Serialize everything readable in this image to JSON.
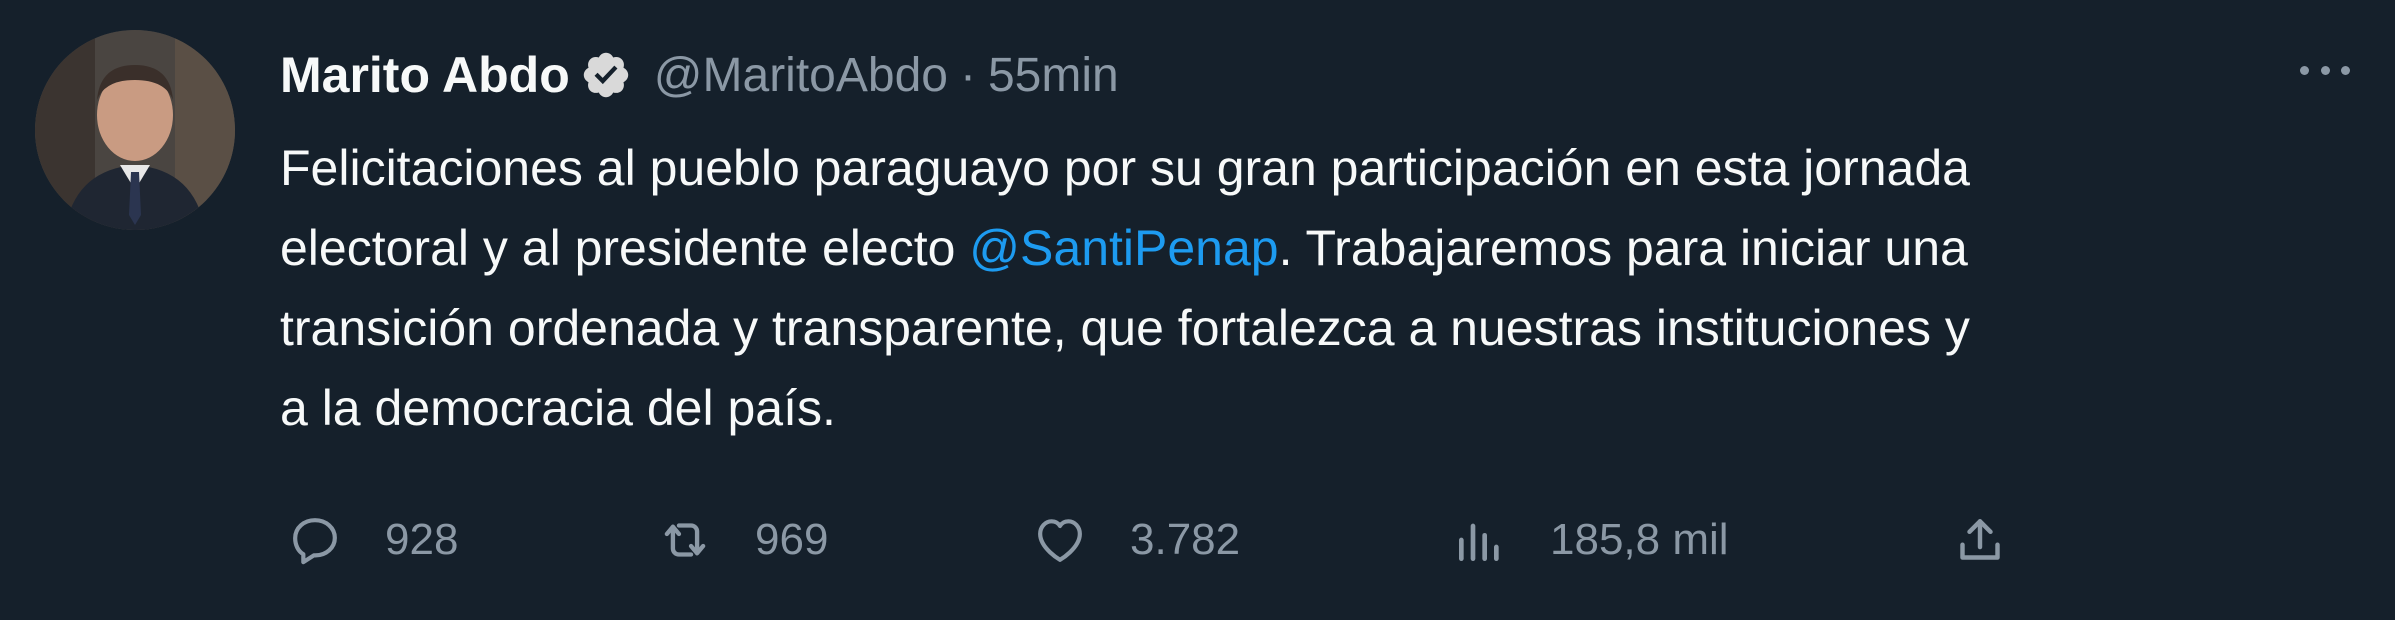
{
  "author": {
    "display_name": "Marito Abdo",
    "handle": "@MaritoAbdo",
    "separator": "·",
    "time": "55min",
    "verified": true
  },
  "tweet": {
    "line1": "Felicitaciones al pueblo paraguayo por su gran participación en esta jornada",
    "line2_before": "electoral y al presidente electo ",
    "line2_mention": "@SantiPenap",
    "line2_after": ". Trabajaremos para iniciar una",
    "line3": "transición ordenada y transparente, que fortalezca a nuestras instituciones y",
    "line4": "a la democracia del país."
  },
  "actions": {
    "reply_count": "928",
    "retweet_count": "969",
    "like_count": "3.782",
    "views_count": "185,8 mil"
  },
  "icons": {
    "reply": "reply-icon",
    "retweet": "retweet-icon",
    "like": "heart-icon",
    "views": "views-icon",
    "share": "share-icon",
    "more": "more-icon",
    "verified": "verified-badge-icon"
  },
  "colors": {
    "background": "#15202b",
    "text": "#f7f9f9",
    "secondary": "#8b98a5",
    "link": "#1d9bf0"
  }
}
